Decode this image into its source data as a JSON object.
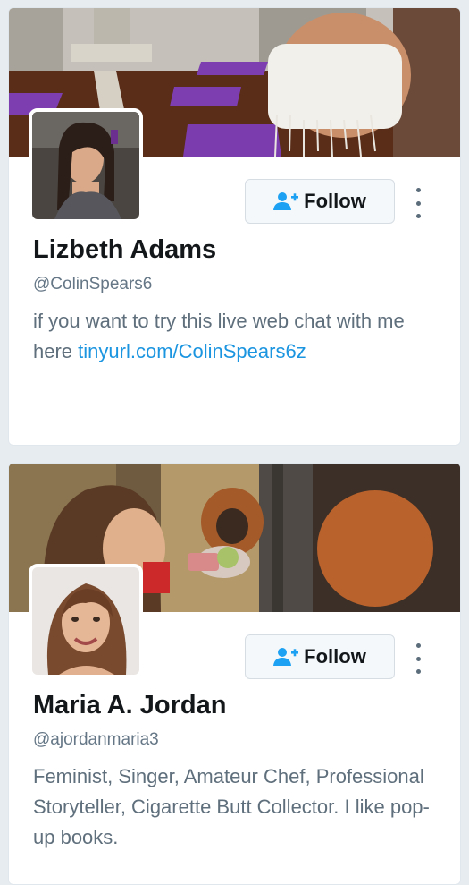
{
  "cards": [
    {
      "name": "Lizbeth Adams",
      "handle": "@ColinSpears6",
      "bio_text": "if you want to try this live web chat with me here ",
      "bio_link": "tinyurl.com/ColinSpears6z",
      "follow_label": "Follow"
    },
    {
      "name": "Maria A. Jordan",
      "handle": "@ajordanmaria3",
      "bio_text": "Feminist, Singer, Amateur Chef, Professional Storyteller, Cigarette Butt Collector. I like pop-up books.",
      "follow_label": "Follow"
    }
  ],
  "icons": {
    "follow": "add-user-icon",
    "more": "more-vertical-icon"
  },
  "colors": {
    "link": "#1b95e0",
    "accent_icon": "#1da1f2",
    "text_primary": "#14171a",
    "text_secondary": "#657786"
  }
}
